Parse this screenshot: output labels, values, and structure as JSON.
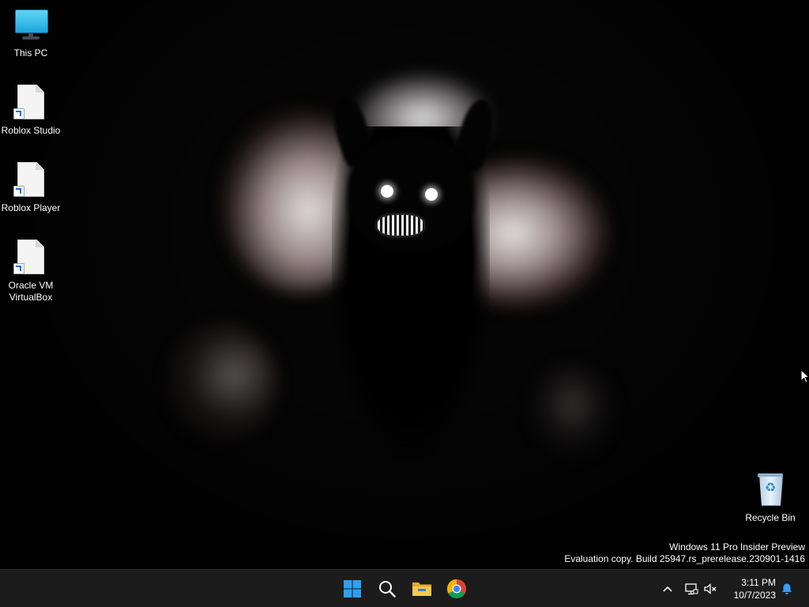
{
  "desktop": {
    "icons": [
      {
        "label": "This PC",
        "icon": "monitor-icon"
      },
      {
        "label": "Roblox Studio",
        "icon": "file-shortcut-icon"
      },
      {
        "label": "Roblox Player",
        "icon": "file-shortcut-icon"
      },
      {
        "label": "Oracle VM VirtualBox",
        "icon": "file-shortcut-icon"
      },
      {
        "label": "Recycle Bin",
        "icon": "recycle-bin-icon"
      }
    ],
    "watermark": {
      "line1": "Windows 11 Pro Insider Preview",
      "line2": "Evaluation copy. Build 25947.rs_prerelease.230901-1416"
    }
  },
  "taskbar": {
    "apps": [
      {
        "name": "Start",
        "icon": "windows-logo-icon"
      },
      {
        "name": "Search",
        "icon": "search-icon"
      },
      {
        "name": "File Explorer",
        "icon": "folder-icon"
      },
      {
        "name": "Google Chrome",
        "icon": "chrome-icon"
      }
    ],
    "tray": {
      "overflow_icon": "chevron-up-icon",
      "network_icon": "network-icon",
      "volume_icon": "volume-muted-icon",
      "notification_icon": "bell-icon",
      "time": "3:11 PM",
      "date": "10/7/2023"
    }
  },
  "colors": {
    "taskbar_bg": "#1c1c1c",
    "accent": "#0078d4",
    "notification": "#3a9cf5"
  }
}
